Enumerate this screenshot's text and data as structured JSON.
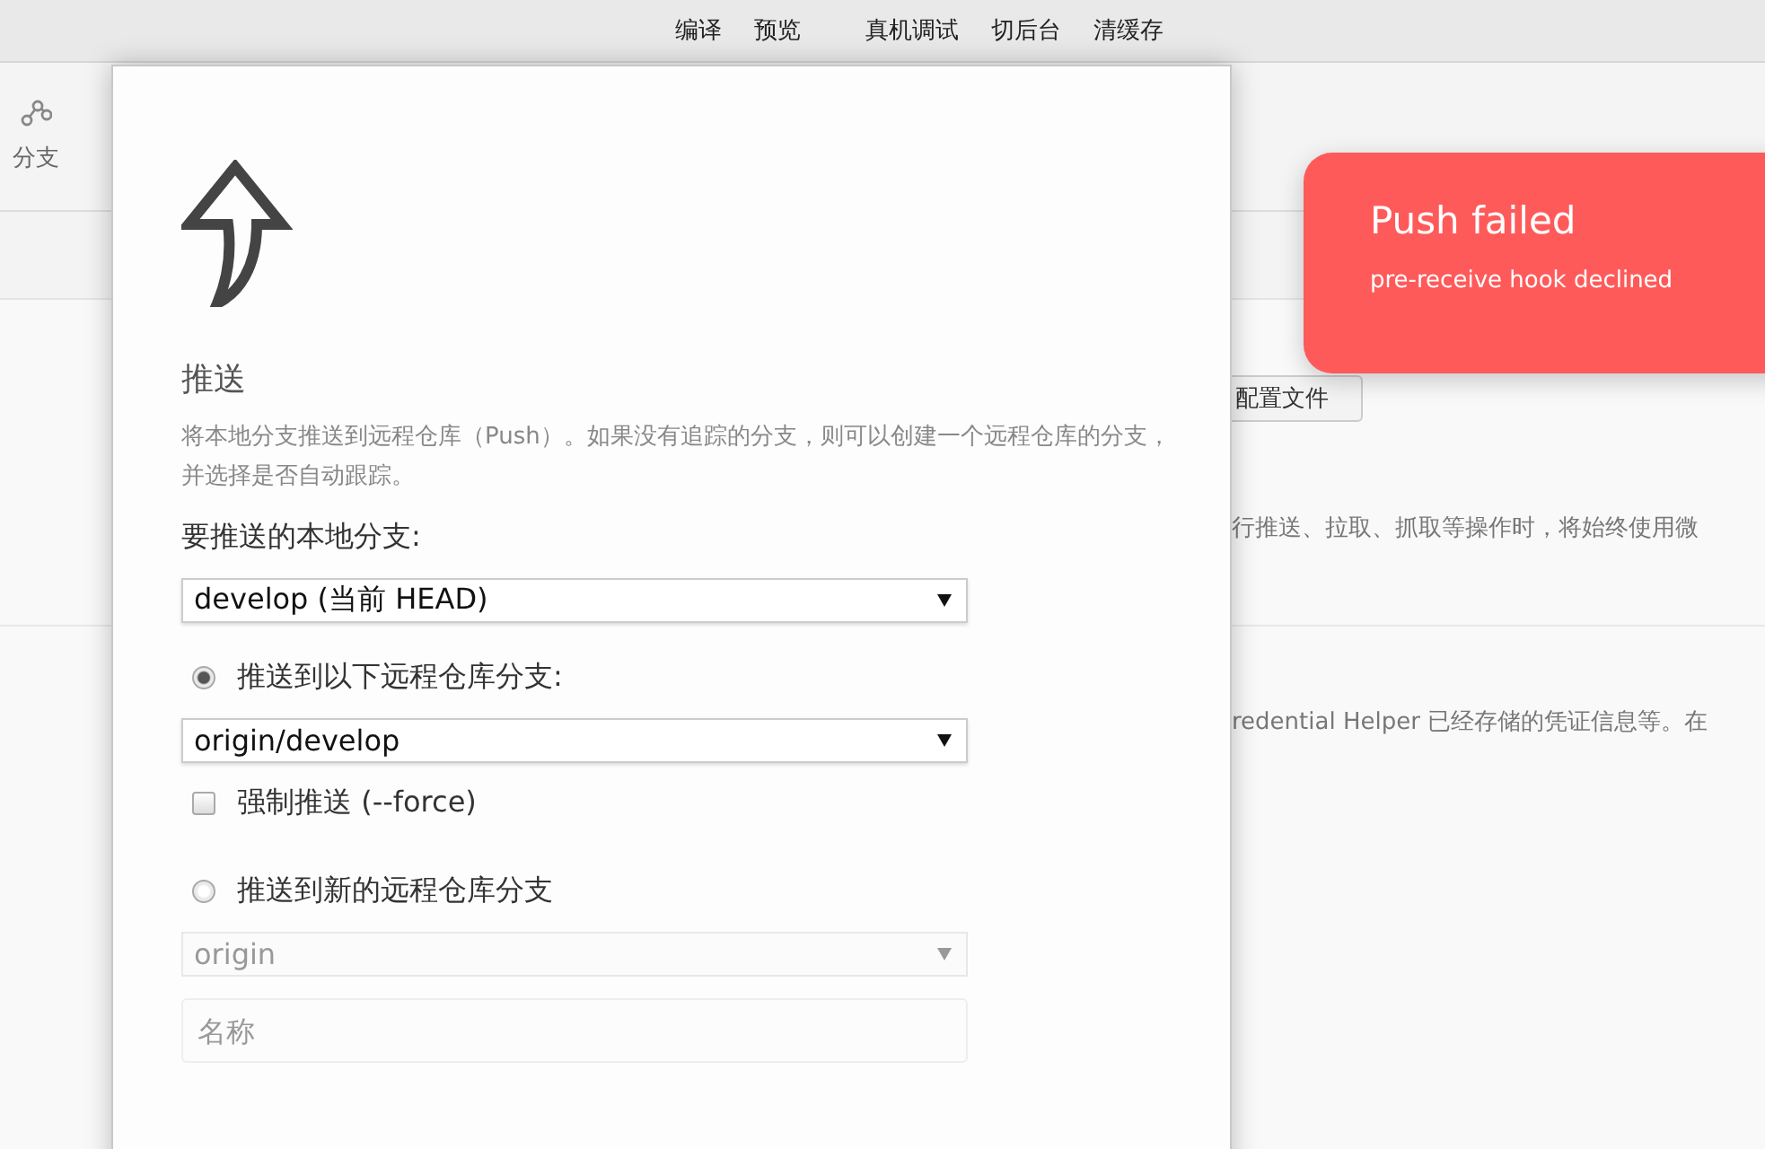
{
  "menu_bar": {
    "items": [
      "编译",
      "预览",
      "真机调试",
      "切后台",
      "清缓存"
    ]
  },
  "toolbar": {
    "items": [
      {
        "label": "分支"
      }
    ]
  },
  "background": {
    "config_button": "配置文件",
    "lines": [
      "行推送、拉取、抓取等操作时，将始终使用微",
      "redential Helper 已经存储的凭证信息等。在"
    ]
  },
  "dialog": {
    "title": "推送",
    "description": "将本地分支推送到远程仓库（Push）。如果没有追踪的分支，则可以创建一个远程仓库的分支，并选择是否自动跟踪。",
    "local_branch_label": "要推送的本地分支:",
    "local_branch": {
      "value": "develop (当前 HEAD)",
      "disabled": false
    },
    "options": [
      {
        "label": "推送到以下远程仓库分支:",
        "selected": true,
        "select": {
          "value": "origin/develop",
          "disabled": false
        },
        "force": {
          "label": "强制推送 (--force)",
          "checked": false
        }
      },
      {
        "label": "推送到新的远程仓库分支",
        "selected": false,
        "select": {
          "value": "origin",
          "disabled": true
        },
        "name_field": {
          "placeholder": "名称"
        }
      }
    ]
  },
  "toast": {
    "title": "Push failed",
    "message": "pre-receive hook declined"
  }
}
